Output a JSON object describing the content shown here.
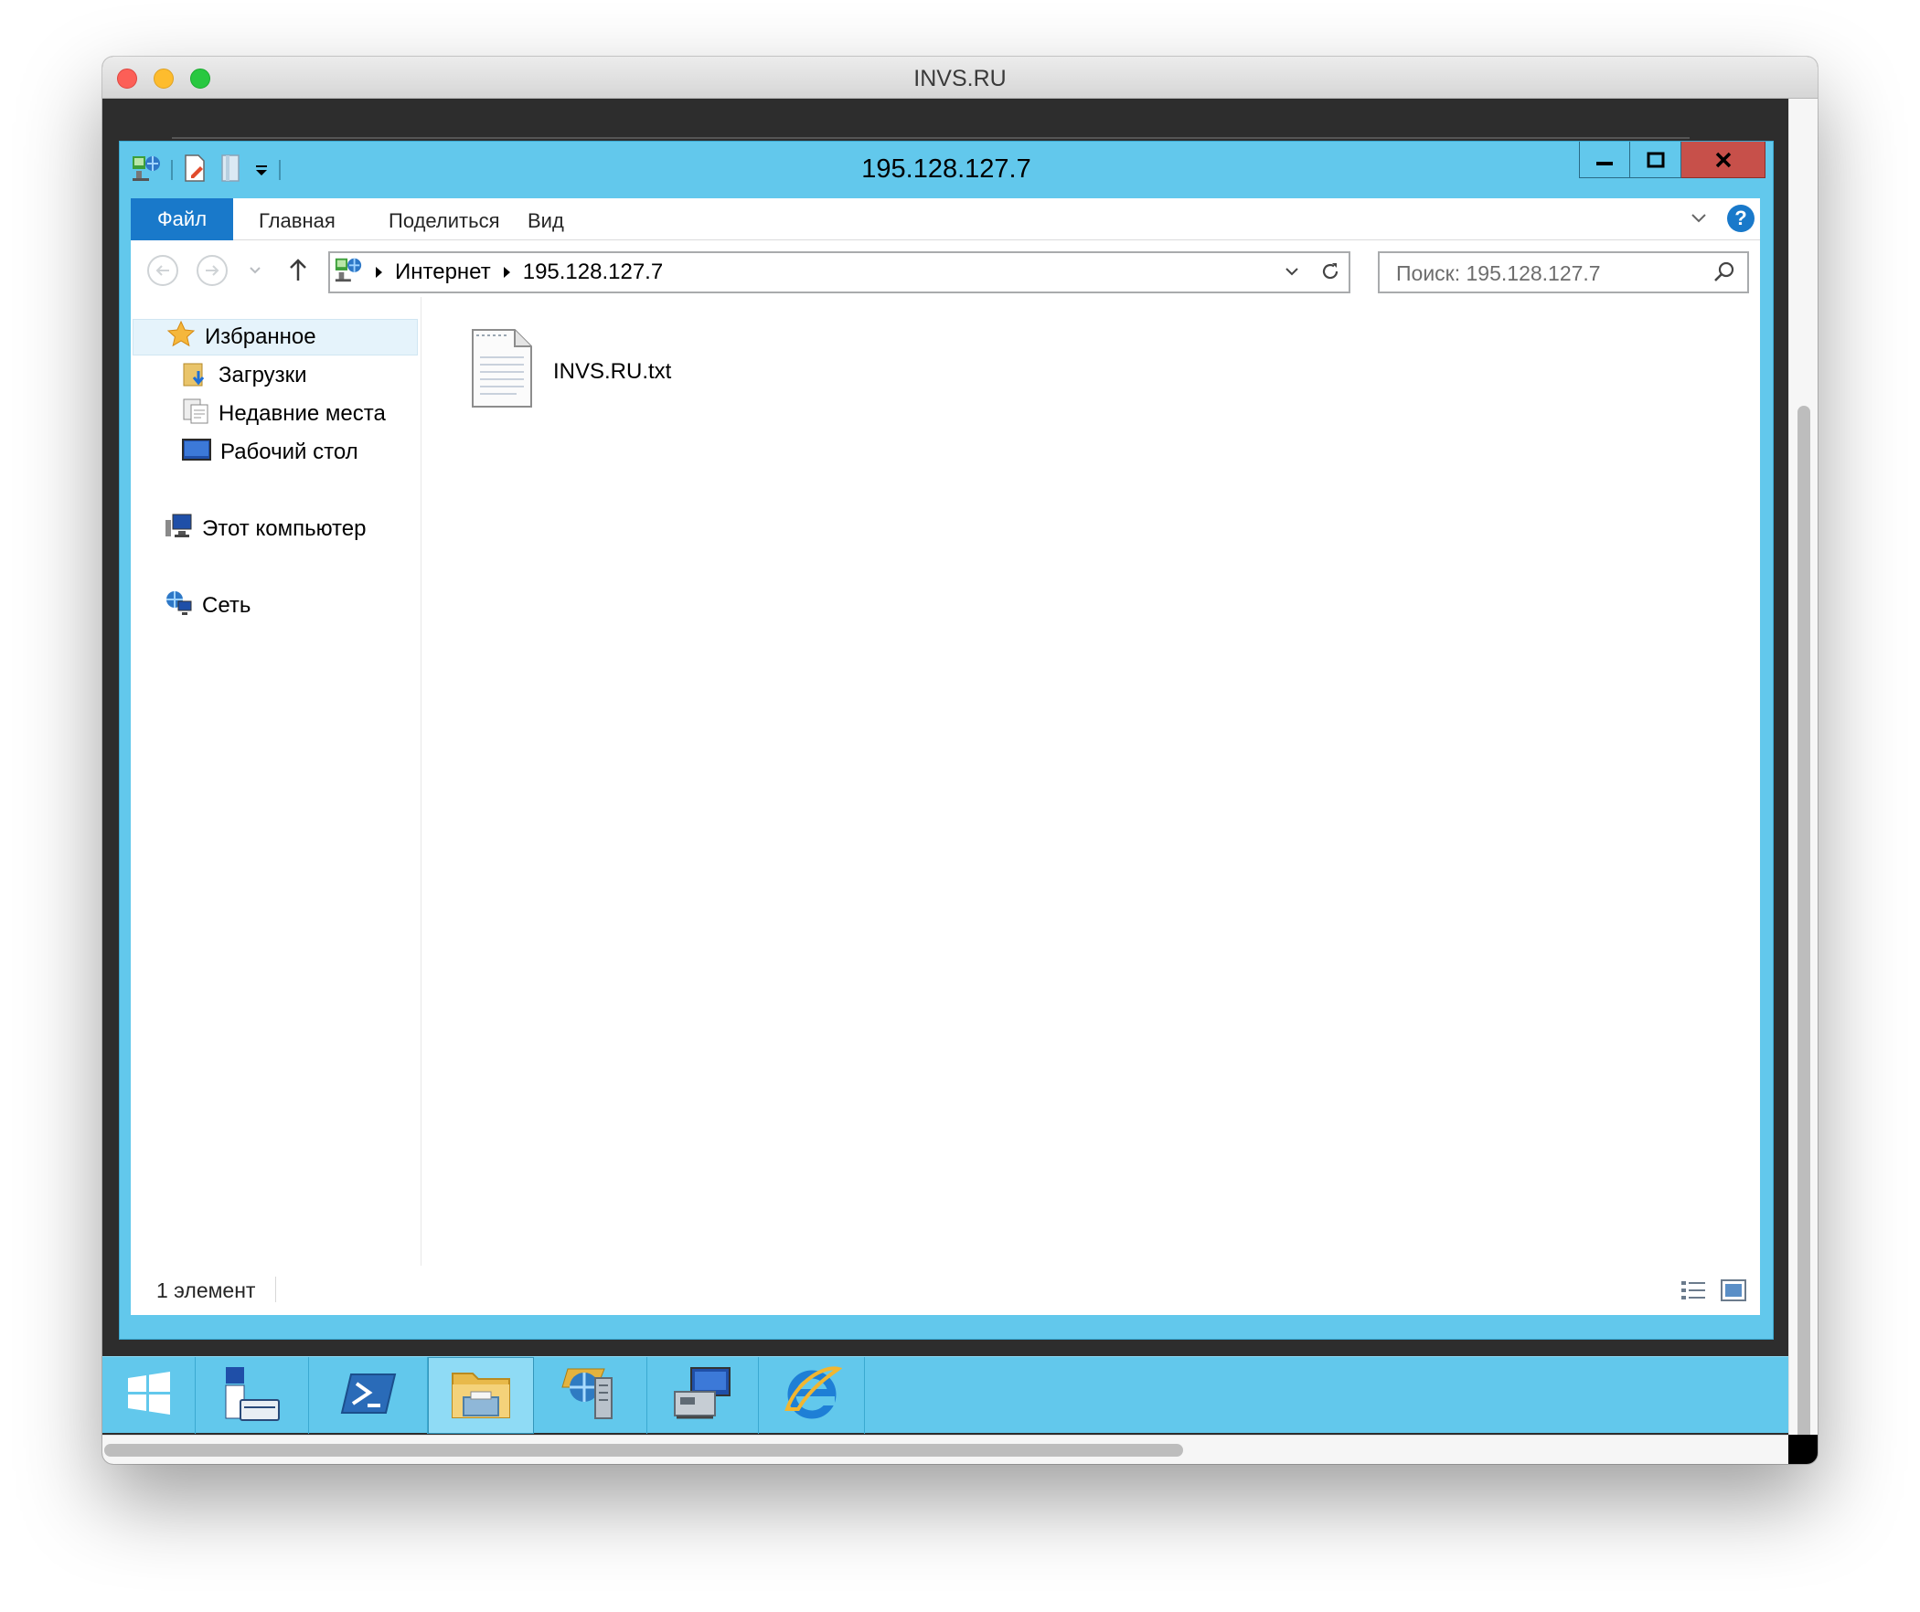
{
  "mac": {
    "title": "INVS.RU"
  },
  "explorer": {
    "title": "195.128.127.7",
    "ribbon": {
      "file_tab": "Файл",
      "tabs": [
        "Главная",
        "Поделиться",
        "Вид"
      ],
      "help_label": "?"
    },
    "address": {
      "crumbs": [
        "Интернет",
        "195.128.127.7"
      ]
    },
    "search": {
      "placeholder": "Поиск: 195.128.127.7"
    },
    "nav": {
      "favorites": "Избранное",
      "downloads": "Загрузки",
      "recent": "Недавние места",
      "desktop": "Рабочий стол",
      "this_pc": "Этот компьютер",
      "network": "Сеть"
    },
    "files": [
      {
        "name": "INVS.RU.txt",
        "icon": "text-document-icon"
      }
    ],
    "status": {
      "count": "1 элемент"
    }
  },
  "taskbar": {
    "items": [
      "start-icon",
      "server-manager-icon",
      "powershell-icon",
      "file-explorer-icon",
      "network-tool-icon",
      "remote-desktop-icon",
      "internet-explorer-icon"
    ]
  },
  "colors": {
    "window_frame": "#62c8ec",
    "ribbon_file_tab": "#1979ca",
    "close_button": "#c7504a",
    "desktop": "#2d2d2d"
  }
}
